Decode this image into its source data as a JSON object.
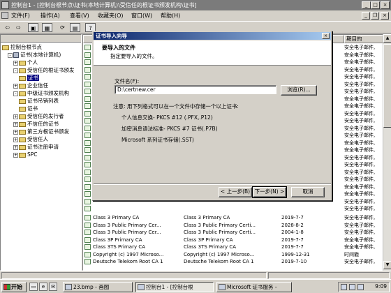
{
  "window": {
    "title": "控制台1 - [控制台根节点\\证书(本地计算机)\\受信任的根证书颁发机构\\证书]"
  },
  "menu": {
    "items": [
      "文件(F)",
      "操作(A)",
      "查看(V)",
      "收藏夹(O)",
      "窗口(W)",
      "帮助(H)"
    ]
  },
  "toolbar": {
    "icons": [
      "back-icon",
      "forward-icon",
      "up-folder-icon",
      "properties-icon",
      "refresh-icon",
      "export-icon",
      "help-icon"
    ]
  },
  "tree": {
    "items": [
      {
        "label": "控制台根节点",
        "level": 0,
        "expander": "",
        "kind": "folder",
        "selected": false
      },
      {
        "label": "证书(本地计算机)",
        "level": 1,
        "expander": "-",
        "kind": "node",
        "selected": false
      },
      {
        "label": "个人",
        "level": 2,
        "expander": "+",
        "kind": "folder",
        "selected": false
      },
      {
        "label": "受信任的根证书颁发",
        "level": 2,
        "expander": "-",
        "kind": "folder",
        "selected": false
      },
      {
        "label": "证书",
        "level": 3,
        "expander": "",
        "kind": "folder",
        "selected": true
      },
      {
        "label": "企业信任",
        "level": 2,
        "expander": "+",
        "kind": "folder",
        "selected": false
      },
      {
        "label": "中级证书颁发机构",
        "level": 2,
        "expander": "-",
        "kind": "folder",
        "selected": false
      },
      {
        "label": "证书吊销列表",
        "level": 3,
        "expander": "",
        "kind": "folder",
        "selected": false
      },
      {
        "label": "证书",
        "level": 3,
        "expander": "",
        "kind": "folder",
        "selected": false
      },
      {
        "label": "受信任的发行者",
        "level": 2,
        "expander": "+",
        "kind": "folder",
        "selected": false
      },
      {
        "label": "不信任的证书",
        "level": 2,
        "expander": "+",
        "kind": "folder",
        "selected": false
      },
      {
        "label": "第三方根证书颁发",
        "level": 2,
        "expander": "+",
        "kind": "folder",
        "selected": false
      },
      {
        "label": "受信任人",
        "level": 2,
        "expander": "+",
        "kind": "folder",
        "selected": false
      },
      {
        "label": "证书注册申请",
        "level": 2,
        "expander": "+",
        "kind": "folder",
        "selected": false
      },
      {
        "label": "SPC",
        "level": 2,
        "expander": "+",
        "kind": "folder",
        "selected": false
      }
    ]
  },
  "list": {
    "columns": [
      "",
      "",
      "",
      "期目的"
    ],
    "rows_top": [
      "安全电子邮件,",
      "安全电子邮件,",
      "安全电子邮件,",
      "安全电子邮件,",
      "安全电子邮件,",
      "安全电子邮件,",
      "安全电子邮件,",
      "安全电子邮件,",
      "安全电子邮件,",
      "安全电子邮件,",
      "安全电子邮件,",
      "安全电子邮件,",
      "安全电子邮件,",
      "安全电子邮件,",
      "安全电子邮件,",
      "安全电子邮件,",
      "安全电子邮件,",
      "安全电子邮件,",
      "安全电子邮件,",
      "安全电子邮件,",
      "安全电子邮件,",
      "安全电子邮件,",
      "安全电子邮件,"
    ],
    "rows_bottom": [
      {
        "issued_to": "Class 3 Primary CA",
        "issued_by": "Class 3 Primary CA",
        "expires": "2019-7-7",
        "purpose": "安全电子邮件,"
      },
      {
        "issued_to": "Class 3 Public Primary Cer...",
        "issued_by": "Class 3 Public Primary Certi...",
        "expires": "2028-8-2",
        "purpose": "安全电子邮件,"
      },
      {
        "issued_to": "Class 3 Public Primary Cer...",
        "issued_by": "Class 3 Public Primary Certi...",
        "expires": "2004-1-8",
        "purpose": "安全电子邮件,"
      },
      {
        "issued_to": "Class 3P Primary CA",
        "issued_by": "Class 3P Primary CA",
        "expires": "2019-7-7",
        "purpose": "安全电子邮件,"
      },
      {
        "issued_to": "Class 3TS Primary CA",
        "issued_by": "Class 3TS Primary CA",
        "expires": "2019-7-7",
        "purpose": "安全电子邮件,"
      },
      {
        "issued_to": "Copyright (c) 1997 Microso...",
        "issued_by": "Copyright (c) 1997 Microso...",
        "expires": "1999-12-31",
        "purpose": "时间戳"
      },
      {
        "issued_to": "Deutsche Telekom Root CA 1",
        "issued_by": "Deutsche Telekom Root CA 1",
        "expires": "2019-7-10",
        "purpose": "安全电子邮件,"
      }
    ]
  },
  "wizard": {
    "title": "证书导入向导",
    "close_label": "×",
    "heading": "要导入的文件",
    "subheading": "指定要导入的文件。",
    "file_label": "文件名(F):",
    "file_value": "D:\\certnew.cer",
    "browse_label": "浏览(R)...",
    "note": "注意: 用下列格式可以在一个文件中存储一个以上证书:",
    "formats": [
      "个人信息交换- PKCS #12 (.PFX,.P12)",
      "加密消息语法标准- PKCS #7 证书(.P7B)",
      "Microsoft 系列证书存储(.SST)"
    ],
    "back_label": "< 上一步(B)",
    "next_label": "下一步(N) >",
    "cancel_label": "取消"
  },
  "taskbar": {
    "start_label": "开始",
    "tasks": [
      {
        "label": "23.bmp - 画图",
        "active": false
      },
      {
        "label": "控制台1 - [控制台根",
        "active": true
      },
      {
        "label": "Microsoft 证书服务 -",
        "active": false
      }
    ],
    "clock": "9:09"
  }
}
